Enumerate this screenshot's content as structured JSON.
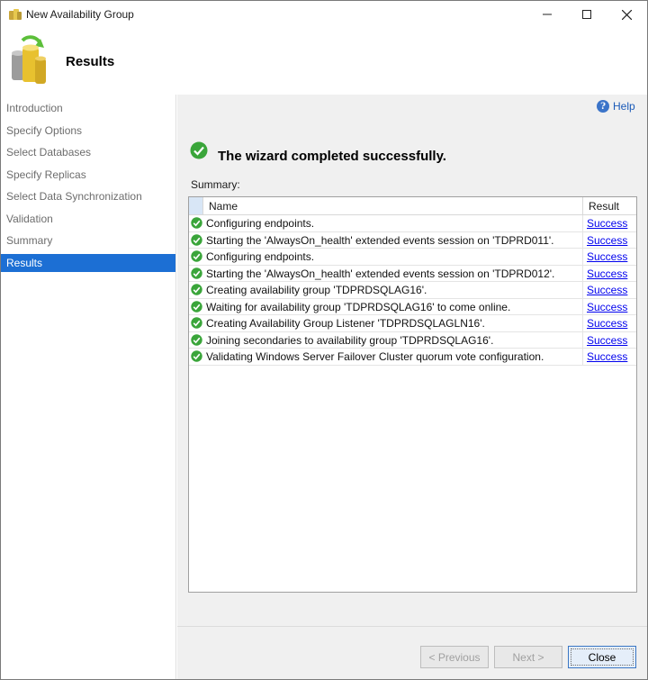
{
  "window": {
    "title": "New Availability Group",
    "controls": {
      "minimize": "minimize-icon",
      "maximize": "maximize-icon",
      "close": "close-icon"
    }
  },
  "header": {
    "title": "Results",
    "icon": "availability-group-icon"
  },
  "sidebar": {
    "items": [
      {
        "label": "Introduction",
        "selected": false
      },
      {
        "label": "Specify Options",
        "selected": false
      },
      {
        "label": "Select Databases",
        "selected": false
      },
      {
        "label": "Specify Replicas",
        "selected": false
      },
      {
        "label": "Select Data Synchronization",
        "selected": false
      },
      {
        "label": "Validation",
        "selected": false
      },
      {
        "label": "Summary",
        "selected": false
      },
      {
        "label": "Results",
        "selected": true
      }
    ]
  },
  "main": {
    "help_label": "Help",
    "status_message": "The wizard completed successfully.",
    "summary_label": "Summary:",
    "table": {
      "columns": [
        "Name",
        "Result"
      ],
      "rows": [
        {
          "name": "Configuring endpoints.",
          "result": "Success"
        },
        {
          "name": "Starting the 'AlwaysOn_health' extended events session on 'TDPRD011'.",
          "result": "Success"
        },
        {
          "name": "Configuring endpoints.",
          "result": "Success"
        },
        {
          "name": "Starting the 'AlwaysOn_health' extended events session on 'TDPRD012'.",
          "result": "Success"
        },
        {
          "name": "Creating availability group 'TDPRDSQLAG16'.",
          "result": "Success"
        },
        {
          "name": "Waiting for availability group 'TDPRDSQLAG16' to come online.",
          "result": "Success"
        },
        {
          "name": "Creating Availability Group Listener 'TDPRDSQLAGLN16'.",
          "result": "Success"
        },
        {
          "name": "Joining secondaries to availability group 'TDPRDSQLAG16'.",
          "result": "Success"
        },
        {
          "name": "Validating Windows Server Failover Cluster quorum vote configuration.",
          "result": "Success"
        }
      ]
    }
  },
  "footer": {
    "previous_label": "< Previous",
    "next_label": "Next >",
    "close_label": "Close"
  },
  "colors": {
    "accent": "#1c6fd4",
    "success": "#3aa53a",
    "link": "#0000ee"
  }
}
